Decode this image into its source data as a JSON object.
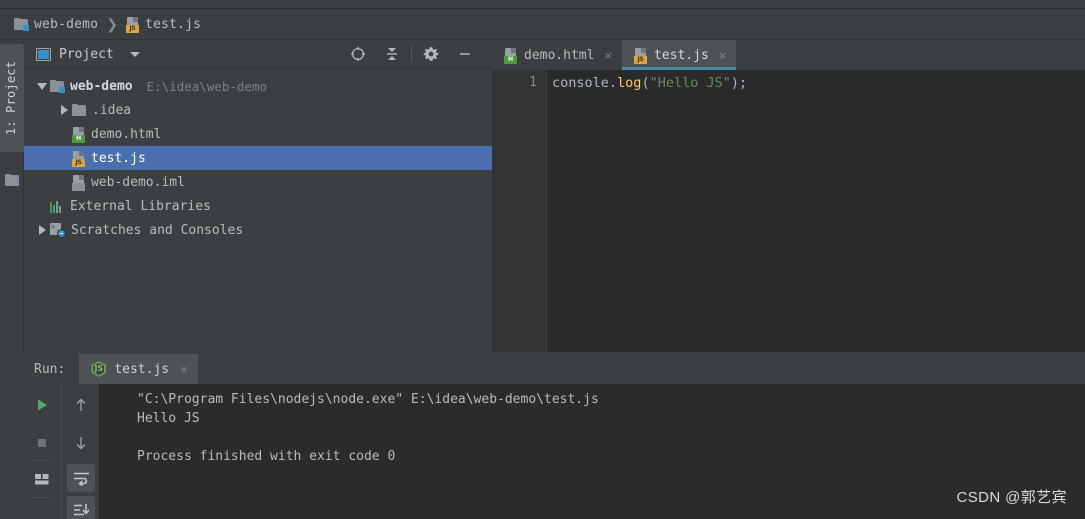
{
  "breadcrumb": {
    "items": [
      {
        "label": "web-demo",
        "icon": "folder-icon"
      },
      {
        "label": "test.js",
        "icon": "js-file-icon"
      }
    ],
    "separator": "❯"
  },
  "left_strip": {
    "tab_label": "1: Project",
    "folder_icon": "folder-icon"
  },
  "project_panel": {
    "title": "Project",
    "icon": "project-icon",
    "actions": [
      {
        "name": "select-opened-file-icon",
        "title": "crosshair"
      },
      {
        "name": "collapse-all-icon",
        "title": "collapse"
      },
      {
        "name": "settings-gear-icon",
        "title": "gear"
      },
      {
        "name": "hide-panel-icon",
        "title": "minimize"
      }
    ],
    "tree": [
      {
        "label": "web-demo",
        "sub": "E:\\idea\\web-demo",
        "icon": "folder-icon",
        "twisty": "down",
        "indent": 0,
        "bold": true,
        "selected": false
      },
      {
        "label": ".idea",
        "sub": "",
        "icon": "folder-plain-icon",
        "twisty": "right",
        "indent": 1,
        "bold": false,
        "selected": false
      },
      {
        "label": "demo.html",
        "sub": "",
        "icon": "html-file-icon",
        "twisty": "none",
        "indent": 1,
        "bold": false,
        "selected": false
      },
      {
        "label": "test.js",
        "sub": "",
        "icon": "js-file-icon",
        "twisty": "none",
        "indent": 1,
        "bold": false,
        "selected": true
      },
      {
        "label": "web-demo.iml",
        "sub": "",
        "icon": "iml-file-icon",
        "twisty": "none",
        "indent": 1,
        "bold": false,
        "selected": false
      },
      {
        "label": "External Libraries",
        "sub": "",
        "icon": "libraries-icon",
        "twisty": "none",
        "indent": 0,
        "bold": false,
        "selected": false
      },
      {
        "label": "Scratches and Consoles",
        "sub": "",
        "icon": "scratches-icon",
        "twisty": "right",
        "indent": 0,
        "bold": false,
        "selected": false
      }
    ]
  },
  "editor": {
    "tabs": [
      {
        "label": "demo.html",
        "icon": "html-file-icon",
        "active": false,
        "close": "×"
      },
      {
        "label": "test.js",
        "icon": "js-file-icon",
        "active": true,
        "close": "×"
      }
    ],
    "line_number": "1",
    "code": {
      "object": "console",
      "dot": ".",
      "method": "log",
      "open_paren": "(",
      "string": "\"Hello JS\"",
      "close_paren": ")",
      "semicolon": ";"
    }
  },
  "run_panel": {
    "label": "Run:",
    "tab": {
      "label": "test.js",
      "icon": "nodejs-icon",
      "close": "×",
      "badge": "JS"
    },
    "buttons": [
      {
        "name": "rerun-button",
        "icon": "play-icon"
      },
      {
        "name": "stop-button",
        "icon": "stop-icon"
      },
      {
        "name": "layout-button",
        "icon": "layout-icon"
      },
      {
        "name": "prev-occurrence-button",
        "icon": "arrow-up-icon"
      },
      {
        "name": "next-occurrence-button",
        "icon": "arrow-down-icon"
      },
      {
        "name": "soft-wrap-button",
        "icon": "soft-wrap-icon"
      },
      {
        "name": "scroll-to-end-button",
        "icon": "scroll-to-end-icon"
      }
    ],
    "output": [
      "\"C:\\Program Files\\nodejs\\node.exe\" E:\\idea\\web-demo\\test.js",
      "Hello JS",
      "",
      "Process finished with exit code 0"
    ]
  },
  "watermark": "CSDN @郭艺宾",
  "colors": {
    "accent_blue": "#4b6eaf",
    "tab_underline": "#4a88a8",
    "string_green": "#6a8759",
    "method_orange": "#ffc66d",
    "js_badge": "#d9a540",
    "html_badge": "#4f9a39",
    "panel_bg": "#3c3f41",
    "editor_bg": "#2b2b2b"
  }
}
